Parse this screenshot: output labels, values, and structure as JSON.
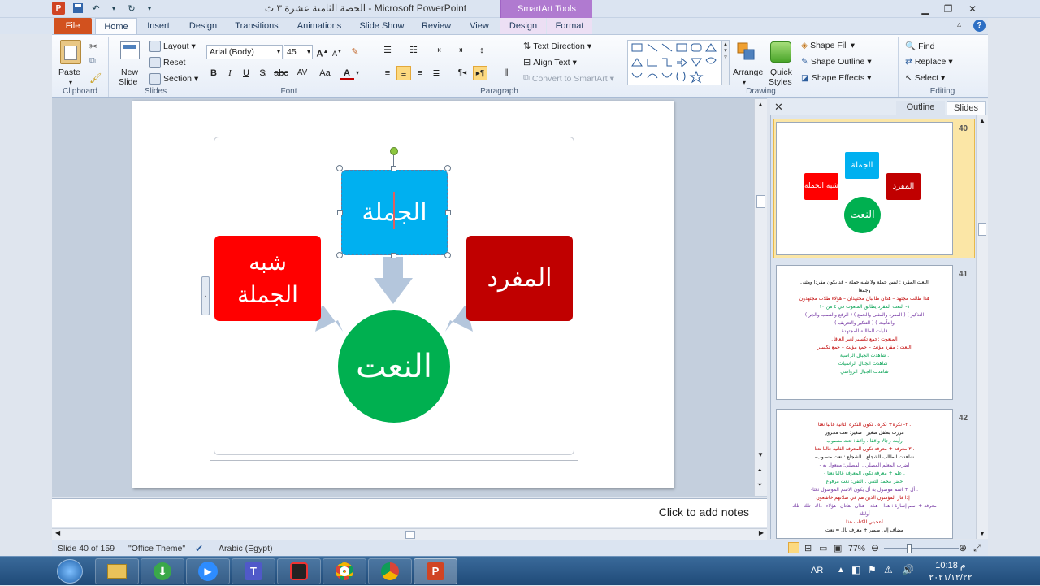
{
  "window": {
    "title": "الحصة الثامنة عشرة ٣ ث  -  Microsoft PowerPoint",
    "contextual_group": "SmartArt Tools",
    "controls": [
      "minimize",
      "restore",
      "close"
    ]
  },
  "tabs": [
    "File",
    "Home",
    "Insert",
    "Design",
    "Transitions",
    "Animations",
    "Slide Show",
    "Review",
    "View"
  ],
  "context_tabs": [
    "Design",
    "Format"
  ],
  "active_tab": "Home",
  "ribbon": {
    "clipboard": {
      "label": "Clipboard",
      "paste": "Paste"
    },
    "slides": {
      "label": "Slides",
      "new_slide_line1": "New",
      "new_slide_line2": "Slide",
      "layout": "Layout",
      "reset": "Reset",
      "section": "Section"
    },
    "font": {
      "label": "Font",
      "family": "Arial (Body)",
      "size": "45",
      "bold": "B",
      "italic": "I",
      "underline": "U",
      "shadow": "S",
      "strike": "abc",
      "spacing": "AV",
      "case": "Aa",
      "color": "A"
    },
    "paragraph": {
      "label": "Paragraph",
      "text_direction": "Text Direction",
      "align_text": "Align Text",
      "convert": "Convert to SmartArt"
    },
    "drawing": {
      "label": "Drawing",
      "arrange": "Arrange",
      "quick_styles_line1": "Quick",
      "quick_styles_line2": "Styles",
      "shape_fill": "Shape Fill",
      "shape_outline": "Shape Outline",
      "shape_effects": "Shape Effects"
    },
    "editing": {
      "label": "Editing",
      "find": "Find",
      "replace": "Replace",
      "select": "Select"
    }
  },
  "smartart": {
    "top": "الجملة",
    "left_line1": "شبه",
    "left_line2": "الجملة",
    "right": "المفرد",
    "center": "النعت",
    "colors": {
      "top": "#00b0f0",
      "left": "#ff0000",
      "right": "#c00000",
      "center": "#00b050",
      "arrow": "#b4c6dc"
    }
  },
  "notes_placeholder": "Click to add notes",
  "panel": {
    "tabs": [
      "Outline",
      "Slides"
    ],
    "active": "Slides",
    "thumbs": [
      {
        "num": "40",
        "top": "الجملة",
        "left": "شبه الجملة",
        "right": "المفرد",
        "center": "النعت"
      },
      {
        "num": "41",
        "lines": [
          {
            "t": "النعت المفرد : ليس جملة ولا شبه جملة – قد يكون مفردا ومثنى",
            "c": "#000000"
          },
          {
            "t": "وجمعا",
            "c": "#000000"
          },
          {
            "t": "هذا طالب مجتهد – هذان طالبان مجتهدان – هؤلاء طلاب مجتهدون",
            "c": "#c00000"
          },
          {
            "t": "١- النعت المفرد يطابق المنعوت في ٤ من ١٠",
            "c": "#00a050"
          },
          {
            "t": "( الرفع والنصب والجر ) ( المفرد والمثنى والجمع ) ( التذكير",
            "c": "#7030a0"
          },
          {
            "t": "والتأنيث ) ( التنكير والتعريف )",
            "c": "#7030a0"
          },
          {
            "t": "قابلت الطالبة المجتهدة",
            "c": "#7030a0"
          },
          {
            "t": "المنعوت :جمع تكسير لغير العاقل",
            "c": "#c00000"
          },
          {
            "t": "النعت : مفرد مؤنث – جمع مؤنث – جمع تكسير",
            "c": "#c00000"
          },
          {
            "t": "شاهدت الجبال الراسية .",
            "c": "#00a050"
          },
          {
            "t": "شاهدت الجبال الراسيات .",
            "c": "#00a050"
          },
          {
            "t": "شاهدت الجبال الرواسي",
            "c": "#00a050"
          }
        ]
      },
      {
        "num": "42",
        "lines": [
          {
            "t": "٢- نكرة+ نكرة . تكون النكرة الثانية غالبا نعتا .",
            "c": "#c00000"
          },
          {
            "t": "مررت بطفل صغير . صغير: نعت مجرور",
            "c": "#000000"
          },
          {
            "t": "رأيت رجالا واقفا . واقفا: نعت منصوب",
            "c": "#00a050"
          },
          {
            "t": "٣-معرفة + معرفة تكون المعرفة الثانية غالبا نعتا .",
            "c": "#c00000"
          },
          {
            "t": "-شاهدت الطالب الشجاع . الشجاع : نعت منصوب",
            "c": "#000000"
          },
          {
            "t": "- اضرب المعلم المصلي . المصلي: مفعول به",
            "c": "#7030a0"
          },
          {
            "t": "- علم + معرفة تكون المعرفة غالبا نعتا .",
            "c": "#00a050"
          },
          {
            "t": "حضر محمد التقي . التقي: نعت مرفوع",
            "c": "#00a050"
          },
          {
            "t": "-أل + اسم موصول به أل يكون الاسم الموصول نعتا .",
            "c": "#7030a0"
          },
          {
            "t": "إذا فاز المؤمنون الذين هم في صلاتهم خاشعون .",
            "c": "#c00000"
          },
          {
            "t": "معرفة + اسم إشارة : هذا – هذه – هذان –هاتان –هؤلاء –ذاك –تلك –تلك",
            "c": "#7030a0"
          },
          {
            "t": "أولئك",
            "c": "#7030a0"
          },
          {
            "t": "أعجبني الكتاب هذا",
            "c": "#c00000"
          },
          {
            "t": "مضاف إلى ضمير + معرف بأل = نعت",
            "c": "#000000"
          }
        ]
      }
    ]
  },
  "status": {
    "slide": "Slide 40 of 159",
    "theme": "\"Office Theme\"",
    "language": "Arabic (Egypt)",
    "zoom": "77%"
  },
  "taskbar": {
    "lang": "AR",
    "time": "10:18 م",
    "date": "٢٠٢١/١٢/٢٢",
    "apps": [
      "start",
      "file-explorer",
      "internet-download-manager",
      "zoom",
      "teams",
      "screen-recorder",
      "chrome",
      "chrome",
      "powerpoint"
    ]
  }
}
